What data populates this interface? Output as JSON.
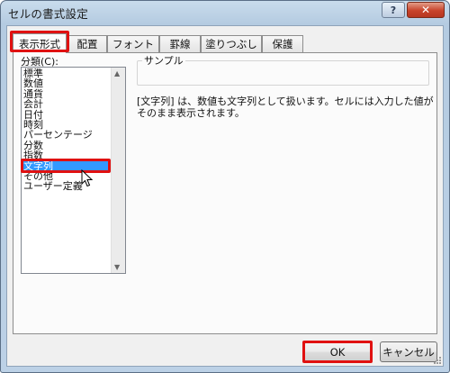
{
  "window": {
    "title": "セルの書式設定"
  },
  "titlebar_buttons": {
    "help": "?",
    "close": "✕"
  },
  "tabs": [
    {
      "label": "表示形式",
      "active": true
    },
    {
      "label": "配置",
      "active": false
    },
    {
      "label": "フォント",
      "active": false
    },
    {
      "label": "罫線",
      "active": false
    },
    {
      "label": "塗りつぶし",
      "active": false
    },
    {
      "label": "保護",
      "active": false
    }
  ],
  "category": {
    "label": "分類(C):",
    "items": [
      "標準",
      "数値",
      "通貨",
      "会計",
      "日付",
      "時刻",
      "パーセンテージ",
      "分数",
      "指数",
      "文字列",
      "その他",
      "ユーザー定義"
    ],
    "selected": "文字列"
  },
  "sample": {
    "label": "サンプル",
    "value": ""
  },
  "description": "[文字列] は、数値も文字列として扱います。セルには入力した値がそのまま表示されます。",
  "buttons": {
    "ok": "OK",
    "cancel": "キャンセル"
  },
  "colors": {
    "highlight": "#e01111",
    "selection": "#3399ff",
    "close_button": "#c8432a"
  },
  "icons": [
    "help-icon",
    "close-icon",
    "scroll-up-arrow-icon",
    "scroll-down-arrow-icon",
    "mouse-pointer-icon",
    "resize-grip-icon"
  ]
}
